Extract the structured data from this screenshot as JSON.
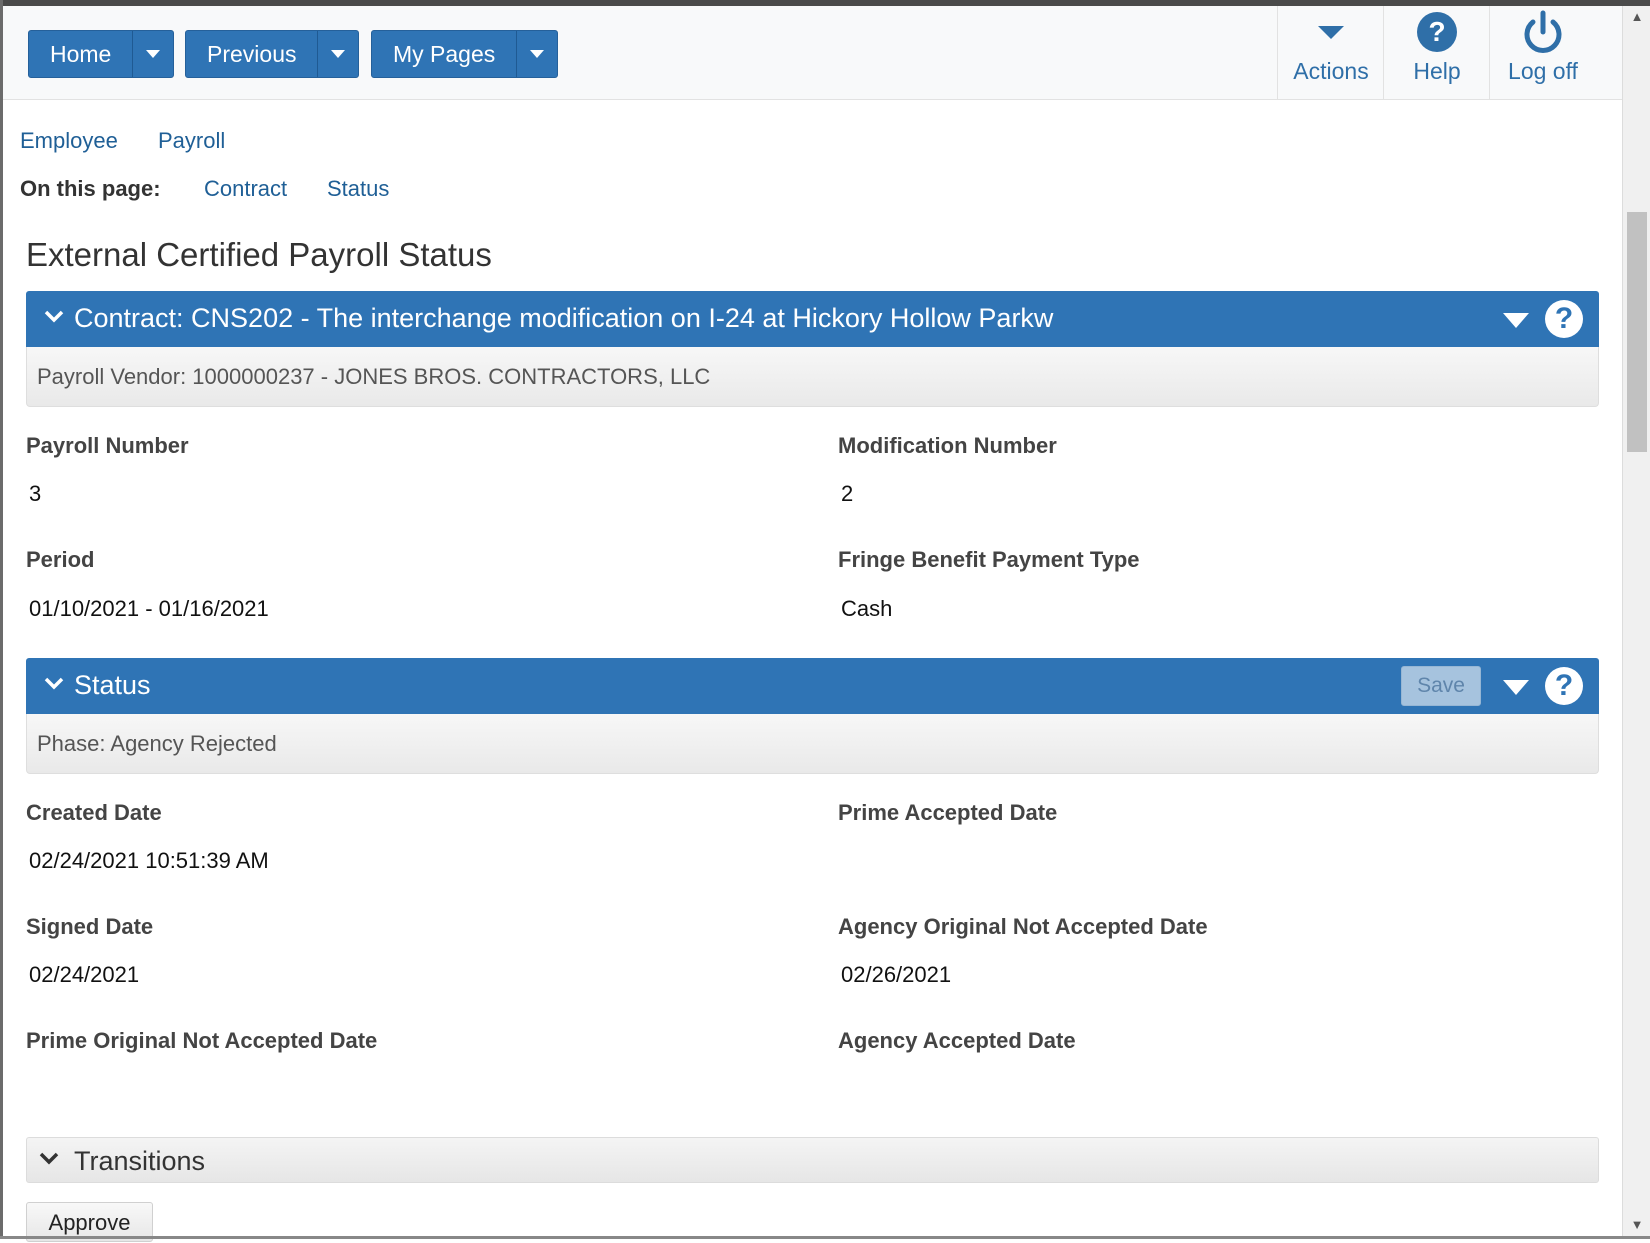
{
  "header": {
    "nav_buttons": [
      {
        "label": "Home"
      },
      {
        "label": "Previous"
      },
      {
        "label": "My Pages"
      }
    ],
    "actions": [
      {
        "label": "Actions",
        "icon": "chevron-down-icon"
      },
      {
        "label": "Help",
        "icon": "help-icon"
      },
      {
        "label": "Log off",
        "icon": "power-icon"
      }
    ]
  },
  "breadcrumbs": [
    "Employee",
    "Payroll"
  ],
  "on_this_page": {
    "label": "On this page:",
    "links": [
      "Contract",
      "Status"
    ]
  },
  "page_title": "External Certified Payroll Status",
  "contract_panel": {
    "title": "Contract: CNS202 - The interchange modification on I-24 at Hickory Hollow Parkw",
    "subtitle": "Payroll Vendor: 1000000237 - JONES BROS. CONTRACTORS, LLC",
    "fields": [
      {
        "label": "Payroll Number",
        "value": "3"
      },
      {
        "label": "Modification Number",
        "value": "2"
      },
      {
        "label": "Period",
        "value": "01/10/2021 - 01/16/2021"
      },
      {
        "label": "Fringe Benefit Payment Type",
        "value": "Cash"
      }
    ]
  },
  "status_panel": {
    "title": "Status",
    "save_label": "Save",
    "subtitle": "Phase: Agency Rejected",
    "fields": [
      {
        "label": "Created Date",
        "value": "02/24/2021 10:51:39 AM"
      },
      {
        "label": "Prime Accepted Date",
        "value": ""
      },
      {
        "label": "Signed Date",
        "value": "02/24/2021"
      },
      {
        "label": "Agency Original Not Accepted Date",
        "value": "02/26/2021"
      },
      {
        "label": "Prime Original Not Accepted Date",
        "value": ""
      },
      {
        "label": "Agency Accepted Date",
        "value": ""
      }
    ]
  },
  "transitions": {
    "title": "Transitions",
    "buttons": [
      "Approve"
    ]
  },
  "colors": {
    "primary": "#2f74b5",
    "link": "#1f5f96"
  }
}
